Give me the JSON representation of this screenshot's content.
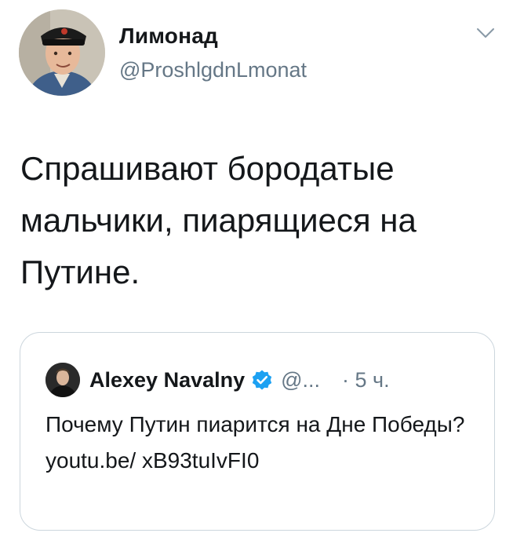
{
  "tweet": {
    "author": {
      "display_name": "Лимонад",
      "handle": "@ProshlgdnLmonat"
    },
    "text": "Спрашивают бородатые мальчики, пиарящиеся на Путине.",
    "menu_icon": "chevron-down-icon"
  },
  "quoted_tweet": {
    "author": {
      "display_name": "Alexey Navalny",
      "verified": true,
      "handle": "@...",
      "time": "· 5 ч."
    },
    "text": "Почему Путин пиарится на Дне Победы? youtu.be/ xB93tuIvFI0"
  },
  "colors": {
    "text": "#14171a",
    "secondary": "#657786",
    "border": "#ccd6dd",
    "verified": "#1da1f2"
  }
}
